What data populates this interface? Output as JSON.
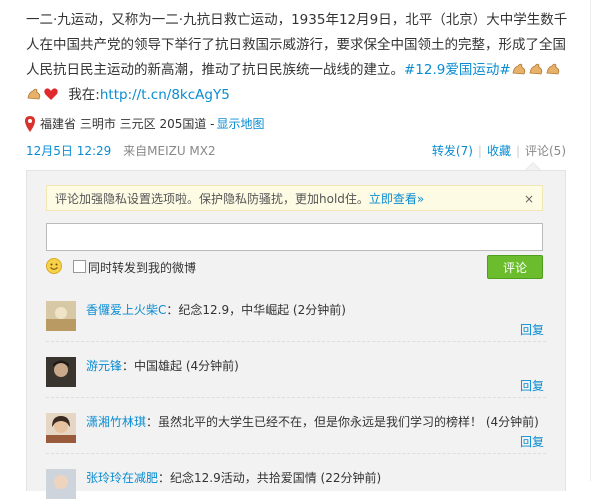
{
  "post": {
    "text": "一二·九运动，又称为一二·九抗日救亡运动，1935年12月9日，北平（北京）大中学生数千人在中国共产党的领导下举行了抗日救国示威游行，要求保全中国领土的完整，形成了全国人民抗日民主运动的新高潮，推动了抗日民族统一战线的建立。",
    "hashtag": "#12.9爱国运动#",
    "see_at": "我在:",
    "short_link": "http://t.cn/8kcAgY5"
  },
  "location": {
    "text": "福建省 三明市 三元区 205国道 -",
    "map_link": "显示地图"
  },
  "meta": {
    "time": "12月5日 12:29",
    "source": "来自MEIZU MX2",
    "forward": "转发(7)",
    "favorite": "收藏",
    "comment": "评论(5)"
  },
  "comments_box": {
    "notice_text": "评论加强隐私设置选项啦。保护隐私防骚扰，更加hold住。",
    "notice_link": "立即查看»",
    "notice_close": "×",
    "input_value": "",
    "forward_label": "同时转发到我的微博",
    "submit_label": "评论"
  },
  "comments": [
    {
      "user": "香儸爱上火柴C",
      "text": "：纪念12.9，中华崛起 (2分钟前)",
      "reply": "回复"
    },
    {
      "user": "游元锋",
      "text": "：中国雄起 (4分钟前)",
      "reply": "回复"
    },
    {
      "user": "潇湘竹林琪",
      "text": "：虽然北平的大学生已经不在，但是你永远是我们学习的榜样！ (4分钟前)",
      "reply": "回复"
    },
    {
      "user": "张玲玲在减肥",
      "text": "：纪念12.9活动，共拾爱国情 (22分钟前)",
      "reply": ""
    }
  ],
  "colors": {
    "link": "#0a8cd2",
    "button": "#6bbd2e",
    "notice_bg": "#fefbe5"
  }
}
